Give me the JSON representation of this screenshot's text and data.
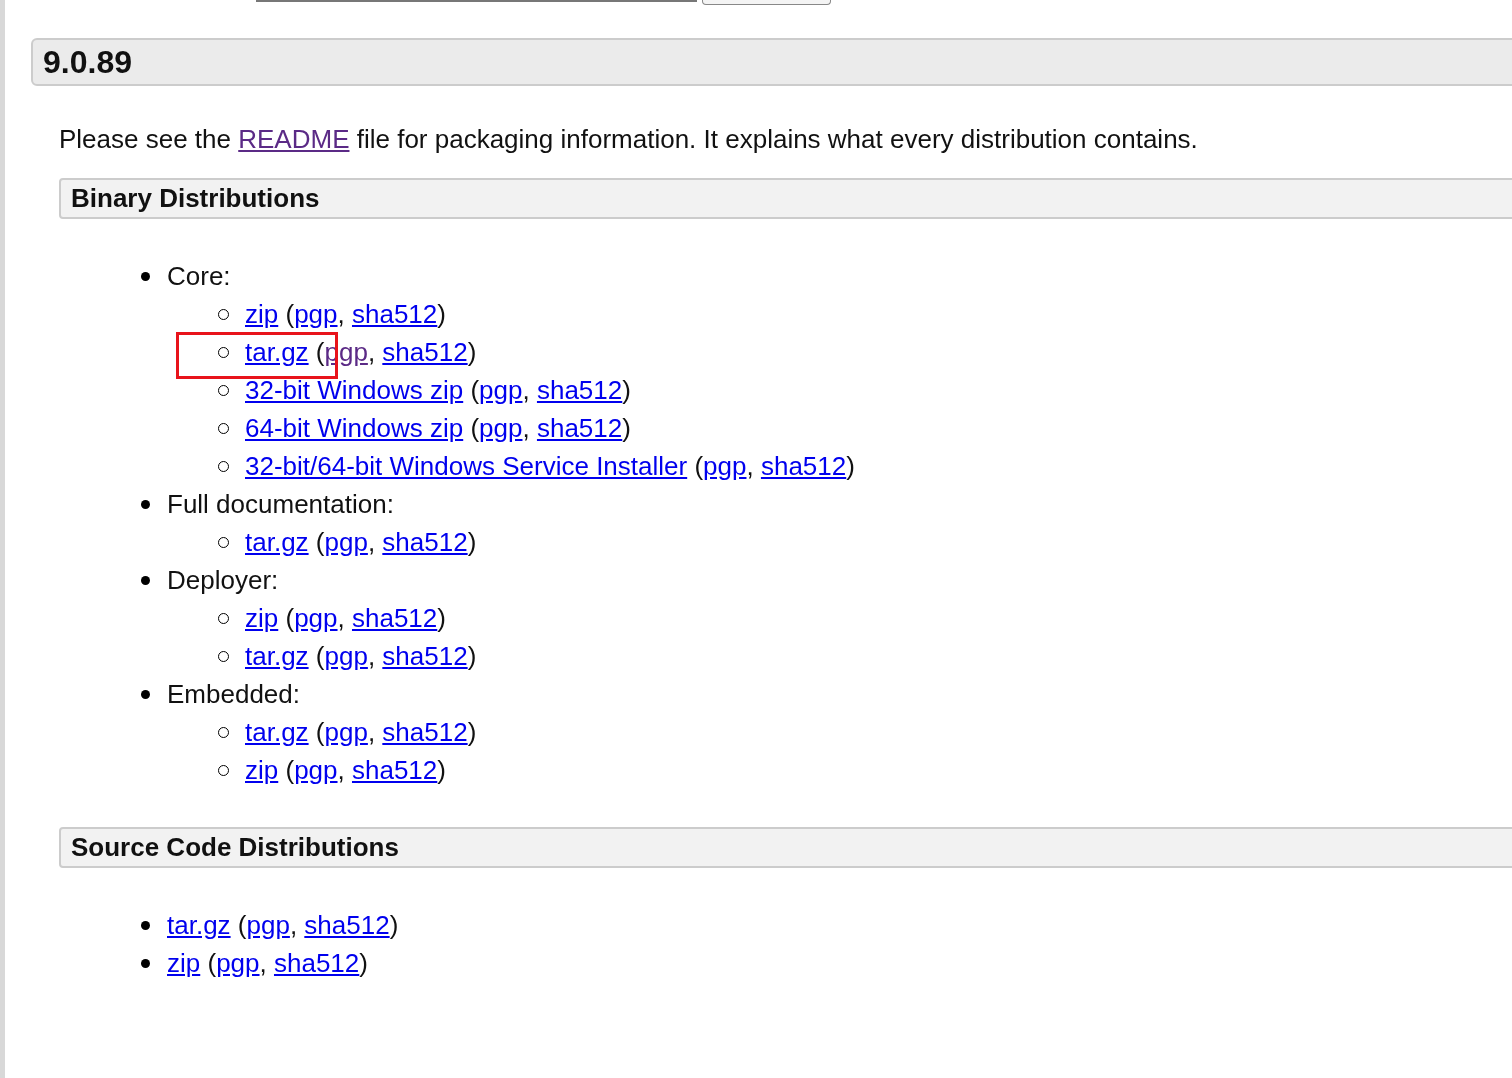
{
  "version": {
    "title": "9.0.89"
  },
  "intro": {
    "before": "Please see the ",
    "link": {
      "text": "README",
      "visited": true
    },
    "after": " file for packaging information. It explains what every distribution contains."
  },
  "sections": [
    {
      "title": "Binary Distributions",
      "items": [
        {
          "label": "Core:",
          "children": [
            {
              "highlighted": false,
              "parts": [
                {
                  "kind": "link",
                  "text": "zip",
                  "visited": false
                },
                {
                  "kind": "text",
                  "text": " ("
                },
                {
                  "kind": "link",
                  "text": "pgp",
                  "visited": false
                },
                {
                  "kind": "text",
                  "text": ", "
                },
                {
                  "kind": "link",
                  "text": "sha512",
                  "visited": false
                },
                {
                  "kind": "text",
                  "text": ")"
                }
              ]
            },
            {
              "highlighted": true,
              "parts": [
                {
                  "kind": "link",
                  "text": "tar.gz",
                  "visited": false
                },
                {
                  "kind": "text",
                  "text": " ("
                },
                {
                  "kind": "link",
                  "text": "pgp",
                  "visited": true
                },
                {
                  "kind": "text",
                  "text": ", "
                },
                {
                  "kind": "link",
                  "text": "sha512",
                  "visited": false
                },
                {
                  "kind": "text",
                  "text": ")"
                }
              ]
            },
            {
              "highlighted": false,
              "parts": [
                {
                  "kind": "link",
                  "text": "32-bit Windows zip",
                  "visited": false
                },
                {
                  "kind": "text",
                  "text": " ("
                },
                {
                  "kind": "link",
                  "text": "pgp",
                  "visited": false
                },
                {
                  "kind": "text",
                  "text": ", "
                },
                {
                  "kind": "link",
                  "text": "sha512",
                  "visited": false
                },
                {
                  "kind": "text",
                  "text": ")"
                }
              ]
            },
            {
              "highlighted": false,
              "parts": [
                {
                  "kind": "link",
                  "text": "64-bit Windows zip",
                  "visited": false
                },
                {
                  "kind": "text",
                  "text": " ("
                },
                {
                  "kind": "link",
                  "text": "pgp",
                  "visited": false
                },
                {
                  "kind": "text",
                  "text": ", "
                },
                {
                  "kind": "link",
                  "text": "sha512",
                  "visited": false
                },
                {
                  "kind": "text",
                  "text": ")"
                }
              ]
            },
            {
              "highlighted": false,
              "parts": [
                {
                  "kind": "link",
                  "text": "32-bit/64-bit Windows Service Installer",
                  "visited": false
                },
                {
                  "kind": "text",
                  "text": " ("
                },
                {
                  "kind": "link",
                  "text": "pgp",
                  "visited": false
                },
                {
                  "kind": "text",
                  "text": ", "
                },
                {
                  "kind": "link",
                  "text": "sha512",
                  "visited": false
                },
                {
                  "kind": "text",
                  "text": ")"
                }
              ]
            }
          ]
        },
        {
          "label": "Full documentation:",
          "children": [
            {
              "highlighted": false,
              "parts": [
                {
                  "kind": "link",
                  "text": "tar.gz",
                  "visited": false
                },
                {
                  "kind": "text",
                  "text": " ("
                },
                {
                  "kind": "link",
                  "text": "pgp",
                  "visited": false
                },
                {
                  "kind": "text",
                  "text": ", "
                },
                {
                  "kind": "link",
                  "text": "sha512",
                  "visited": false
                },
                {
                  "kind": "text",
                  "text": ")"
                }
              ]
            }
          ]
        },
        {
          "label": "Deployer:",
          "children": [
            {
              "highlighted": false,
              "parts": [
                {
                  "kind": "link",
                  "text": "zip",
                  "visited": false
                },
                {
                  "kind": "text",
                  "text": " ("
                },
                {
                  "kind": "link",
                  "text": "pgp",
                  "visited": false
                },
                {
                  "kind": "text",
                  "text": ", "
                },
                {
                  "kind": "link",
                  "text": "sha512",
                  "visited": false
                },
                {
                  "kind": "text",
                  "text": ")"
                }
              ]
            },
            {
              "highlighted": false,
              "parts": [
                {
                  "kind": "link",
                  "text": "tar.gz",
                  "visited": false
                },
                {
                  "kind": "text",
                  "text": " ("
                },
                {
                  "kind": "link",
                  "text": "pgp",
                  "visited": false
                },
                {
                  "kind": "text",
                  "text": ", "
                },
                {
                  "kind": "link",
                  "text": "sha512",
                  "visited": false
                },
                {
                  "kind": "text",
                  "text": ")"
                }
              ]
            }
          ]
        },
        {
          "label": "Embedded:",
          "children": [
            {
              "highlighted": false,
              "parts": [
                {
                  "kind": "link",
                  "text": "tar.gz",
                  "visited": false
                },
                {
                  "kind": "text",
                  "text": " ("
                },
                {
                  "kind": "link",
                  "text": "pgp",
                  "visited": false
                },
                {
                  "kind": "text",
                  "text": ", "
                },
                {
                  "kind": "link",
                  "text": "sha512",
                  "visited": false
                },
                {
                  "kind": "text",
                  "text": ")"
                }
              ]
            },
            {
              "highlighted": false,
              "parts": [
                {
                  "kind": "link",
                  "text": "zip",
                  "visited": false
                },
                {
                  "kind": "text",
                  "text": " ("
                },
                {
                  "kind": "link",
                  "text": "pgp",
                  "visited": false
                },
                {
                  "kind": "text",
                  "text": ", "
                },
                {
                  "kind": "link",
                  "text": "sha512",
                  "visited": false
                },
                {
                  "kind": "text",
                  "text": ")"
                }
              ]
            }
          ]
        }
      ]
    },
    {
      "title": "Source Code Distributions",
      "items": [
        {
          "parts": [
            {
              "kind": "link",
              "text": "tar.gz",
              "visited": false
            },
            {
              "kind": "text",
              "text": " ("
            },
            {
              "kind": "link",
              "text": "pgp",
              "visited": false
            },
            {
              "kind": "text",
              "text": ", "
            },
            {
              "kind": "link",
              "text": "sha512",
              "visited": false
            },
            {
              "kind": "text",
              "text": ")"
            }
          ]
        },
        {
          "parts": [
            {
              "kind": "link",
              "text": "zip",
              "visited": false
            },
            {
              "kind": "text",
              "text": " ("
            },
            {
              "kind": "link",
              "text": "pgp",
              "visited": false
            },
            {
              "kind": "text",
              "text": ", "
            },
            {
              "kind": "link",
              "text": "sha512",
              "visited": false
            },
            {
              "kind": "text",
              "text": ")"
            }
          ]
        }
      ]
    }
  ]
}
